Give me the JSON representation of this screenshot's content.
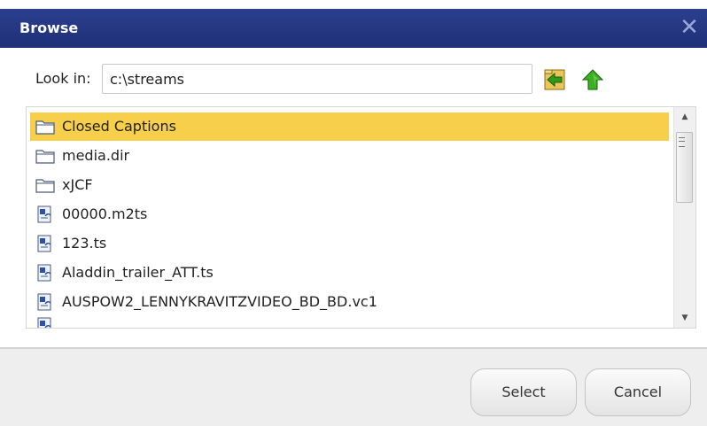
{
  "dialog": {
    "title": "Browse",
    "close_symbol": "✕"
  },
  "lookin": {
    "label": "Look in:",
    "path": "c:\\streams"
  },
  "toolbar": {
    "back_icon": "folder-back-icon",
    "up_icon": "up-arrow-icon"
  },
  "files": [
    {
      "name": "Closed Captions",
      "type": "folder",
      "selected": true
    },
    {
      "name": "media.dir",
      "type": "folder",
      "selected": false
    },
    {
      "name": "xJCF",
      "type": "folder",
      "selected": false
    },
    {
      "name": "00000.m2ts",
      "type": "file",
      "selected": false
    },
    {
      "name": "123.ts",
      "type": "file",
      "selected": false
    },
    {
      "name": "Aladdin_trailer_ATT.ts",
      "type": "file",
      "selected": false
    },
    {
      "name": "AUSPOW2_LENNYKRAVITZVIDEO_BD_BD.vc1",
      "type": "file",
      "selected": false
    }
  ],
  "buttons": {
    "select": "Select",
    "cancel": "Cancel"
  },
  "colors": {
    "titlebar": "#24358a",
    "selection": "#f7cf4b",
    "toolbar_green": "#2f9a1a"
  }
}
